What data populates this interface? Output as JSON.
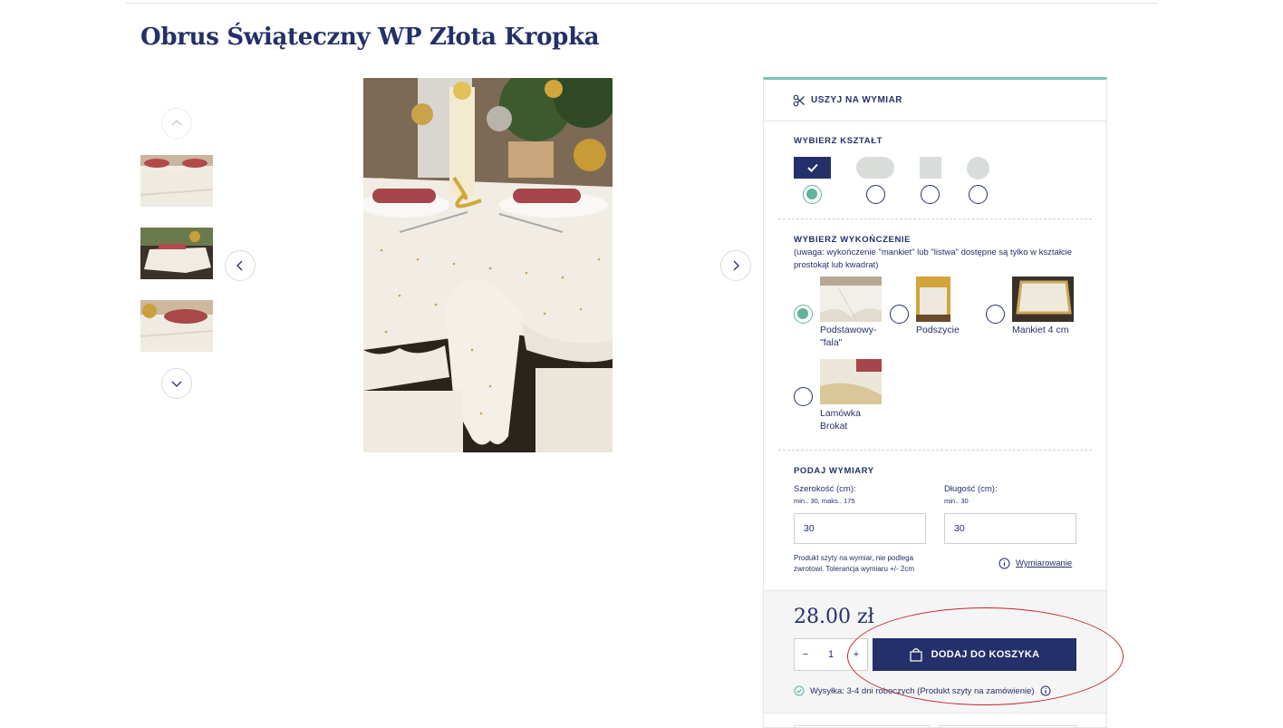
{
  "product": {
    "title": "Obrus Świąteczny WP Złota Kropka"
  },
  "panel": {
    "header": "USZYJ NA WYMIAR",
    "shape": {
      "label": "WYBIERZ KSZTAŁT",
      "options": [
        {
          "name": "prostokąt",
          "selected": true
        },
        {
          "name": "owal",
          "selected": false
        },
        {
          "name": "kwadrat",
          "selected": false
        },
        {
          "name": "okrąg",
          "selected": false
        }
      ]
    },
    "finish": {
      "label": "WYBIERZ WYKOŃCZENIE",
      "note": "(uwaga: wykończenie \"mankiet\" lub \"listwa\" dostępne są tylko w kształcie prostokąt lub kwadrat)",
      "options": [
        {
          "label": "Podstawowy-\"fala\"",
          "selected": true
        },
        {
          "label": "Podszycie",
          "selected": false
        },
        {
          "label": "Mankiet 4 cm",
          "selected": false
        },
        {
          "label": "Lamówka Brokat",
          "selected": false
        }
      ]
    },
    "dimensions": {
      "label": "PODAJ WYMIARY",
      "width_label": "Szerokość (cm):",
      "width_hint": "min.. 30, maks.. 175",
      "width_value": "30",
      "length_label": "Długość (cm):",
      "length_hint": "min.. 30",
      "length_value": "30",
      "disclaimer": "Produkt szyty na wymiar, nie podlega zwrotowi. Tolerancja wymiaru +/- 2cm",
      "measure_link": "Wymiarowanie"
    },
    "buy": {
      "price": "28.00 zł",
      "qty_minus": "−",
      "qty_value": "1",
      "qty_plus": "+",
      "add_to_cart": "DODAJ DO KOSZYKA",
      "shipping": "Wysyłka: 3-4 dni roboczych (Produkt szyty na zamówienie)"
    }
  },
  "colors": {
    "navy": "#24306a",
    "accent": "#5fb39d",
    "annotation": "#c8232c"
  }
}
